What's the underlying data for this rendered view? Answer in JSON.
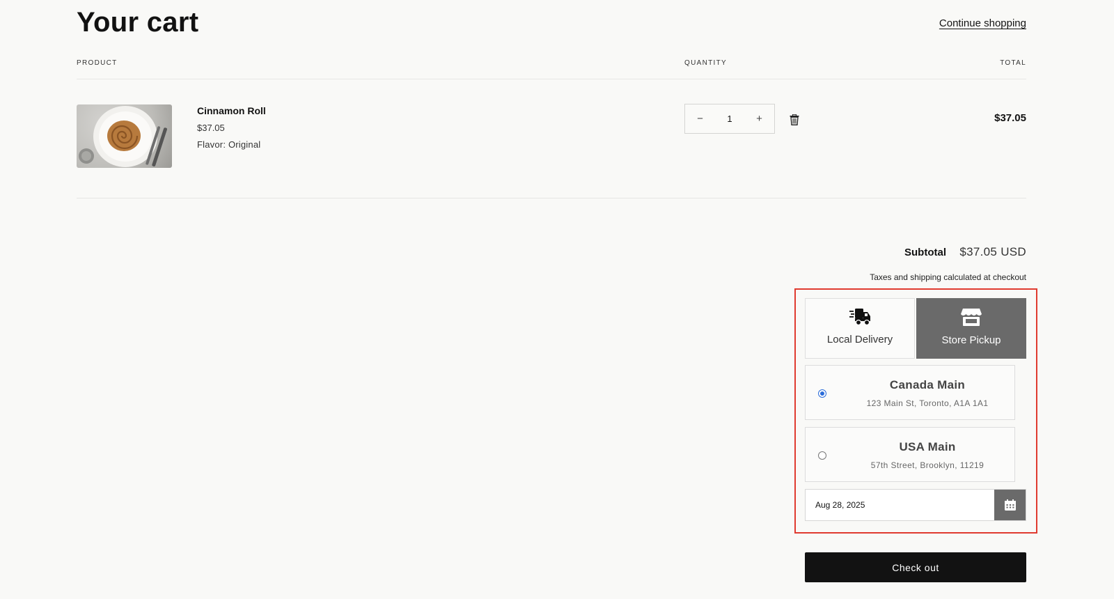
{
  "header": {
    "title": "Your cart",
    "continue_label": "Continue shopping"
  },
  "columns": {
    "product": "PRODUCT",
    "quantity": "QUANTITY",
    "total": "TOTAL"
  },
  "cart_items": [
    {
      "name": "Cinnamon Roll",
      "price": "$37.05",
      "variant": "Flavor: Original",
      "quantity": "1",
      "line_total": "$37.05",
      "decrease_symbol": "−",
      "increase_symbol": "+"
    }
  ],
  "summary": {
    "subtotal_label": "Subtotal",
    "subtotal_value": "$37.05 USD",
    "tax_note": "Taxes and shipping calculated at checkout"
  },
  "fulfillment": {
    "tabs": [
      {
        "label": "Local Delivery",
        "icon": "delivery-truck-icon",
        "selected": false
      },
      {
        "label": "Store Pickup",
        "icon": "storefront-icon",
        "selected": true
      }
    ],
    "locations": [
      {
        "name": "Canada Main",
        "address": "123 Main St, Toronto, A1A 1A1",
        "selected": true
      },
      {
        "name": "USA Main",
        "address": "57th Street, Brooklyn, 11219",
        "selected": false
      }
    ],
    "date_value": "Aug 28, 2025",
    "date_icon": "calendar-icon",
    "highlight_color": "#e03a2f",
    "selected_tab_color": "#6a6a6a",
    "radio_color": "#2b6cd9"
  },
  "checkout_label": "Check out"
}
